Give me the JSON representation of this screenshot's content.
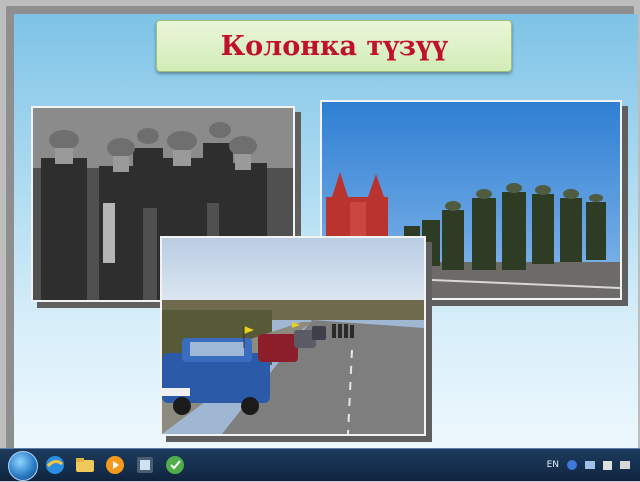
{
  "slide": {
    "title": "Колонка түзүү"
  },
  "images": [
    {
      "name": "soldiers-photo",
      "caption": ""
    },
    {
      "name": "parade-photo",
      "caption": ""
    },
    {
      "name": "car-column-photo",
      "caption": ""
    }
  ],
  "taskbar": {
    "language": "EN",
    "pinned": [
      "start-icon",
      "ie-icon",
      "folder-icon",
      "media-player-icon",
      "app-icon",
      "browser-icon"
    ]
  },
  "colors": {
    "title_text": "#c0102a",
    "title_bg": "#d3ecb7",
    "taskbar": "#163150"
  }
}
